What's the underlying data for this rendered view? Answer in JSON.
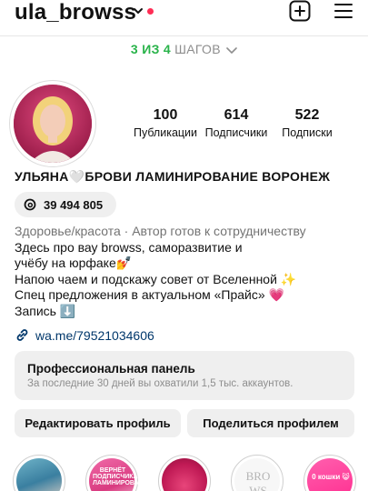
{
  "header": {
    "username": "ula_browss"
  },
  "steps": {
    "done": "3",
    "of_word": "ИЗ",
    "total": "4",
    "word": "ШАГОВ"
  },
  "stats": [
    {
      "value": "100",
      "label": "Публикации"
    },
    {
      "value": "614",
      "label": "Подписчики"
    },
    {
      "value": "522",
      "label": "Подписки"
    }
  ],
  "profile": {
    "full_name": "УЛЬЯНА🤍БРОВИ ЛАМИНИРОВАНИЕ ВОРОНЕЖ",
    "threads_count": "39 494 805"
  },
  "bio": {
    "category": "Здоровье/красота",
    "category_note": " · Автор готов к сотрудничеству",
    "lines": [
      "Здесь про вау browss, саморазвитие и",
      "учёбу на юрфаке💅",
      "Напою чаем и подскажу совет от Вселенной ✨",
      "Спец предложения в актуальном «Прайс» 💗",
      "Запись ⬇️"
    ]
  },
  "link": {
    "text": "wa.me/79521034606"
  },
  "pro_panel": {
    "title": "Профессиональная панель",
    "subtitle": "За последние 30 дней вы охватили 1,5 тыс. аккаунтов."
  },
  "buttons": {
    "edit": "Редактировать профиль",
    "share": "Поделиться профилем"
  },
  "highlights": [
    {
      "label": ""
    },
    {
      "label": "ВЕРНЁТ ПОДПИСЧИКАМ ЛАМИНИРОВАНИЕ"
    },
    {
      "label": ""
    },
    {
      "label": "BRO WS"
    },
    {
      "label": "0 кошки 😸"
    }
  ],
  "colors": {
    "accent_green": "#29b34a",
    "notification_red": "#ff2d55",
    "link_blue": "#00376b",
    "button_gray": "#efefef"
  }
}
